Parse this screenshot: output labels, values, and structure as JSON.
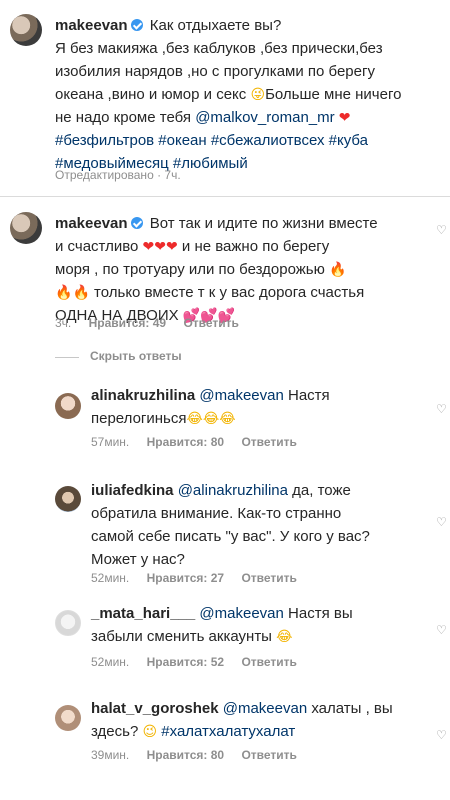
{
  "caption": {
    "username": "makeevan",
    "text_lines": [
      "Как отдыхаете вы?",
      "Я без макияжа ,без каблуков ,без прически,без",
      "изобилия нарядов ,но с прогулками по берегу",
      "океана ,вино и юмор и секс",
      "Больше мне ничего",
      "не надо кроме тебя",
      "@malkov_roman_mr",
      "#безфильтров #океан #сбежалиотвсех #куба",
      "#медовыймесяц #любимый"
    ],
    "edited": "Отредактировано · 7ч."
  },
  "comments": [
    {
      "username": "makeevan",
      "lines": [
        "Вот так и идите по жизни вместе",
        "и счастливо",
        "и не важно по берегу",
        "моря , по тротуару или по бездорожью",
        "только вместе т к у вас дорога счастья",
        "ОДНА  НА ДВОИХ"
      ],
      "time": "3ч.",
      "likes": "Нравится: 49",
      "reply": "Ответить"
    }
  ],
  "hide_replies": "Скрыть ответы",
  "replies": [
    {
      "username": "alinakruzhilina",
      "mention": "@makeevan",
      "lines": [
        "Настя",
        "перелогинься"
      ],
      "time": "57мин.",
      "likes": "Нравится: 80",
      "reply": "Ответить"
    },
    {
      "username": "iuliafedkina",
      "mention": "@alinakruzhilina",
      "lines": [
        "да, тоже",
        "обратила внимание. Как-то странно",
        "самой себе писать \"у вас\". У кого у вас?",
        "Может у нас?"
      ],
      "time": "52мин.",
      "likes": "Нравится: 27",
      "reply": "Ответить"
    },
    {
      "username": "_mata_hari___",
      "mention": "@makeevan",
      "lines": [
        "Настя вы",
        "забыли сменить аккаунты"
      ],
      "time": "52мин.",
      "likes": "Нравится: 52",
      "reply": "Ответить"
    },
    {
      "username": "halat_v_goroshek",
      "mention": "@makeevan",
      "lines": [
        "халаты , вы",
        "здесь?",
        "#халатхалатухалат"
      ],
      "time": "39мин.",
      "likes": "Нравится: 80",
      "reply": "Ответить"
    }
  ]
}
